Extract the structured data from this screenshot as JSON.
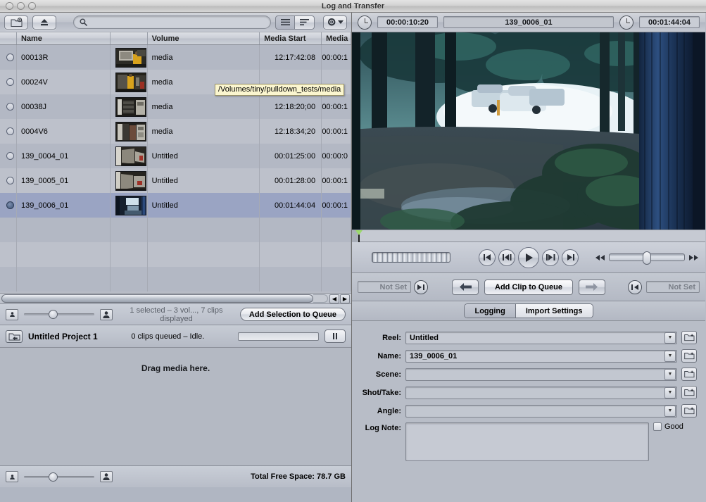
{
  "window": {
    "title": "Log and Transfer"
  },
  "left": {
    "toolbar": {
      "add_folder_icon": "add-folder-icon",
      "eject_icon": "eject-icon",
      "search_placeholder": "",
      "search_value": "",
      "view_list_icon": "list-view-icon",
      "view_detail_icon": "detail-view-icon",
      "action_gear_icon": "gear-icon"
    },
    "columns": [
      "",
      "Name",
      "",
      "Volume",
      "Media Start",
      "Media D"
    ],
    "rows": [
      {
        "selected": false,
        "name": "00013R",
        "volume": "media",
        "media_start": "12:17:42:08",
        "media_duration": "00:00:1"
      },
      {
        "selected": false,
        "name": "00024V",
        "volume": "media",
        "media_start": "",
        "media_duration": ""
      },
      {
        "selected": false,
        "name": "00038J",
        "volume": "media",
        "media_start": "12:18:20;00",
        "media_duration": "00:00:1"
      },
      {
        "selected": false,
        "name": "0004V6",
        "volume": "media",
        "media_start": "12:18:34;20",
        "media_duration": "00:00:1"
      },
      {
        "selected": false,
        "name": "139_0004_01",
        "volume": "Untitled",
        "media_start": "00:01:25:00",
        "media_duration": "00:00:0"
      },
      {
        "selected": false,
        "name": "139_0005_01",
        "volume": "Untitled",
        "media_start": "00:01:28:00",
        "media_duration": "00:00:1"
      },
      {
        "selected": true,
        "name": "139_0006_01",
        "volume": "Untitled",
        "media_start": "00:01:44:04",
        "media_duration": "00:00:1"
      }
    ],
    "tooltip": "/Volumes/tiny/pulldown_tests/media",
    "status": "1 selected – 3 vol..., 7 clips displayed",
    "add_selection_button": "Add Selection to Queue",
    "project": {
      "name": "Untitled Project 1",
      "status": "0 clips queued – Idle.",
      "pause_icon": "pause-icon"
    },
    "dropzone": "Drag media here.",
    "free_space": "Total Free Space: 78.7 GB"
  },
  "right": {
    "timecode_in": "00:00:10:20",
    "clip_name": "139_0006_01",
    "timecode_out": "00:01:44:04",
    "transport": {
      "go_start_icon": "go-to-start-icon",
      "prev_frame_icon": "previous-frame-icon",
      "play_icon": "play-icon",
      "next_frame_icon": "next-frame-icon",
      "go_end_icon": "go-to-end-icon",
      "rewind_icon": "rewind-icon",
      "fastforward_icon": "fast-forward-icon"
    },
    "mark_in_value": "Not Set",
    "mark_out_value": "Not Set",
    "prev_clip_icon": "left-arrow-icon",
    "next_clip_icon": "right-arrow-icon",
    "add_clip_button": "Add Clip to Queue",
    "tabs": [
      {
        "label": "Logging",
        "active": true
      },
      {
        "label": "Import Settings",
        "active": false
      }
    ],
    "fields": [
      {
        "label": "Reel:",
        "value": "Untitled"
      },
      {
        "label": "Name:",
        "value": "139_0006_01"
      },
      {
        "label": "Scene:",
        "value": ""
      },
      {
        "label": "Shot/Take:",
        "value": ""
      },
      {
        "label": "Angle:",
        "value": ""
      }
    ],
    "log_note_label": "Log Note:",
    "log_note_value": "",
    "good_label": "Good",
    "good_checked": false
  },
  "colors": {
    "selection_blue": "#9aa4c3",
    "tooltip_yellow": "#fbf6cf",
    "chrome_gray": "#b8bdc7"
  }
}
